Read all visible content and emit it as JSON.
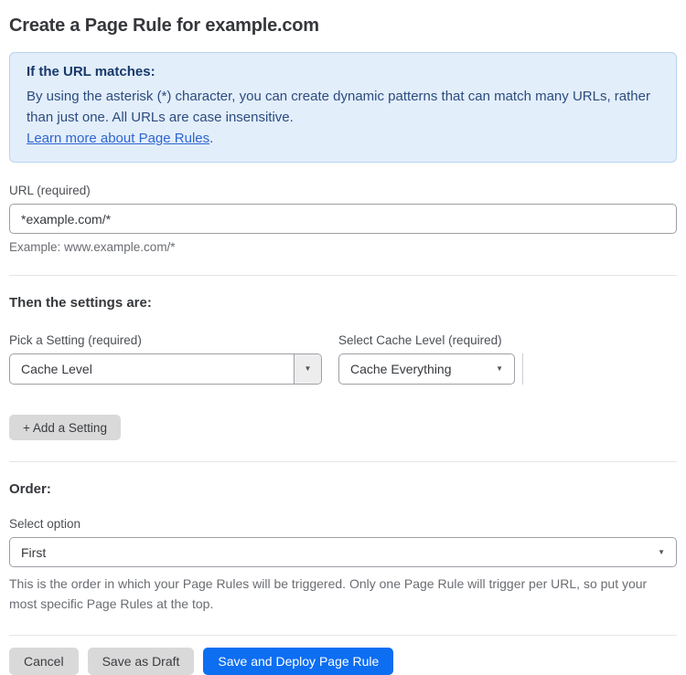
{
  "page": {
    "title": "Create a Page Rule for example.com"
  },
  "info_box": {
    "heading": "If the URL matches:",
    "body": "By using the asterisk (*) character, you can create dynamic patterns that can match many URLs, rather than just one. All URLs are case insensitive.",
    "link_label": "Learn more about Page Rules",
    "link_suffix": "."
  },
  "url_field": {
    "label": "URL (required)",
    "value": "*example.com/*",
    "helper": "Example: www.example.com/*"
  },
  "settings_section": {
    "heading": "Then the settings are:",
    "setting_picker": {
      "label": "Pick a Setting (required)",
      "value": "Cache Level"
    },
    "cache_level_picker": {
      "label": "Select Cache Level (required)",
      "value": "Cache Everything"
    },
    "add_setting_label": "+ Add a Setting"
  },
  "order_section": {
    "heading": "Order:",
    "label": "Select option",
    "value": "First",
    "helper": "This is the order in which your Page Rules will be triggered. Only one Page Rule will trigger per URL, so put your most specific Page Rules at the top."
  },
  "actions": {
    "cancel_label": "Cancel",
    "save_draft_label": "Save as Draft",
    "save_deploy_label": "Save and Deploy Page Rule"
  },
  "icons": {
    "dropdown_arrow": "▼"
  },
  "colors": {
    "info_bg": "#e3eefb",
    "info_border": "#b8d4f1",
    "info_heading": "#17396b",
    "info_body": "#2b4c7e",
    "link": "#2e66d0",
    "primary": "#0d6ef2",
    "secondary": "#d9d9d9"
  }
}
